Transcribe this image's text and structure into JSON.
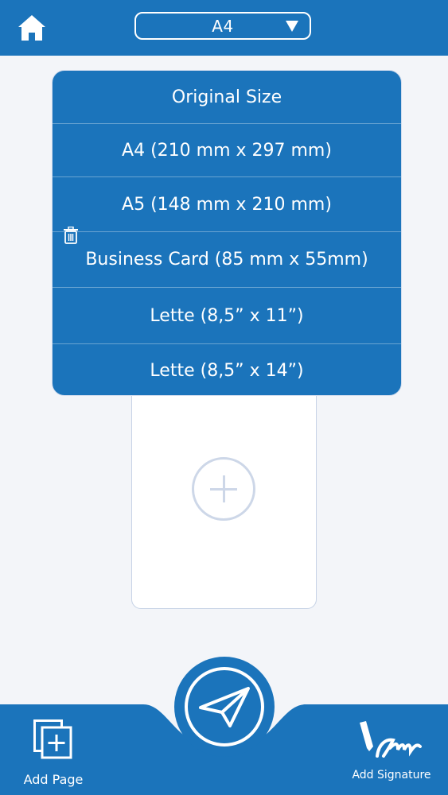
{
  "header": {
    "home_icon": "home-icon",
    "selected_size": "A4",
    "dropdown_icon": "triangle-down-icon"
  },
  "size_menu": {
    "options": [
      {
        "label": "Original Size"
      },
      {
        "label": "A4 (210 mm x 297 mm)"
      },
      {
        "label": "A5 (148 mm x 210 mm)"
      },
      {
        "label": "Business Card (85 mm x 55mm)"
      },
      {
        "label": "Lette (8,5” x 11”)"
      },
      {
        "label": "Lette (8,5” x 14”)"
      }
    ]
  },
  "page_card": {
    "add_icon": "plus-circle-icon",
    "delete_icon": "trash-icon"
  },
  "bottom_bar": {
    "add_page_label": "Add Page",
    "add_signature_label": "Add Signature",
    "send_icon": "paper-plane-icon"
  },
  "colors": {
    "primary": "#1b74bb",
    "background": "#f3f5f9",
    "card_border": "#c7d3e6"
  }
}
